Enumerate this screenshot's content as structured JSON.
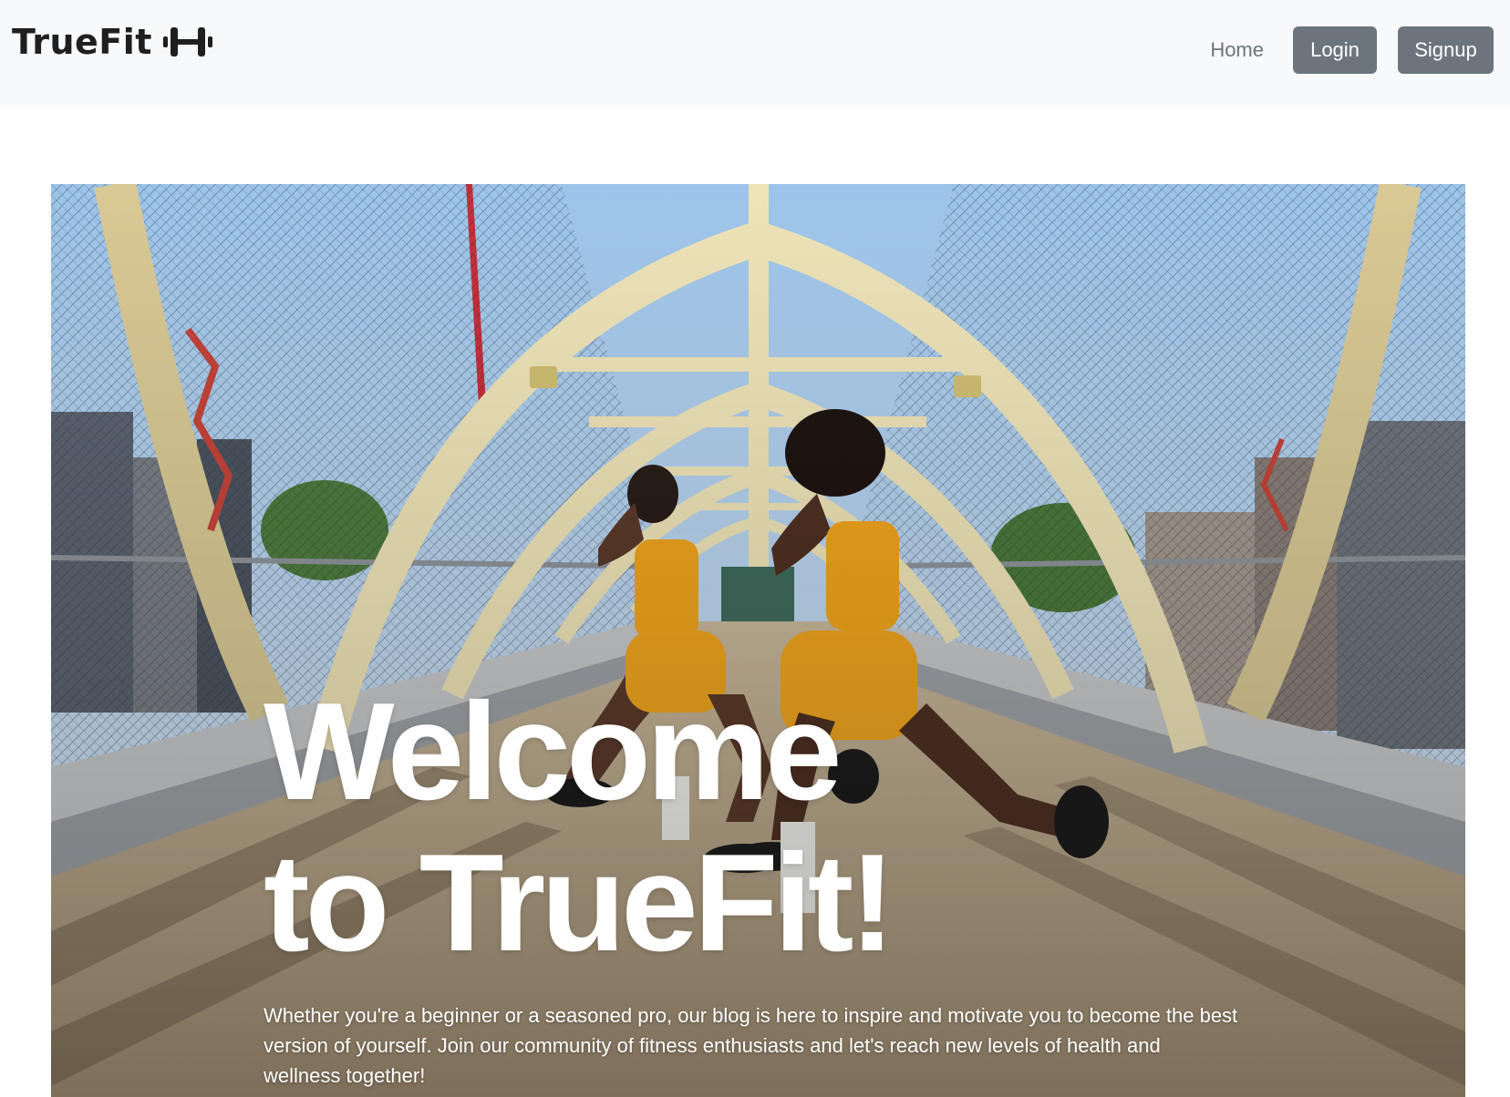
{
  "brand": {
    "name": "TrueFit",
    "icon": "dumbbell-icon"
  },
  "nav": {
    "home_label": "Home",
    "login_label": "Login",
    "signup_label": "Signup"
  },
  "hero": {
    "title": "Welcome to TrueFit!",
    "subtitle": "Whether you're a beginner or a seasoned pro, our blog is here to inspire and motivate you to become the best version of yourself. Join our community of fitness enthusiasts and let's reach new levels of health and wellness together!",
    "image_alt_label": "Two women in yellow workout outfits doing lunges on a pedestrian bridge"
  },
  "colors": {
    "navbar_bg": "#f8f9fa",
    "button_bg": "#6c757d",
    "brand_text": "#1f1f1f",
    "link_muted": "#6c757d"
  }
}
